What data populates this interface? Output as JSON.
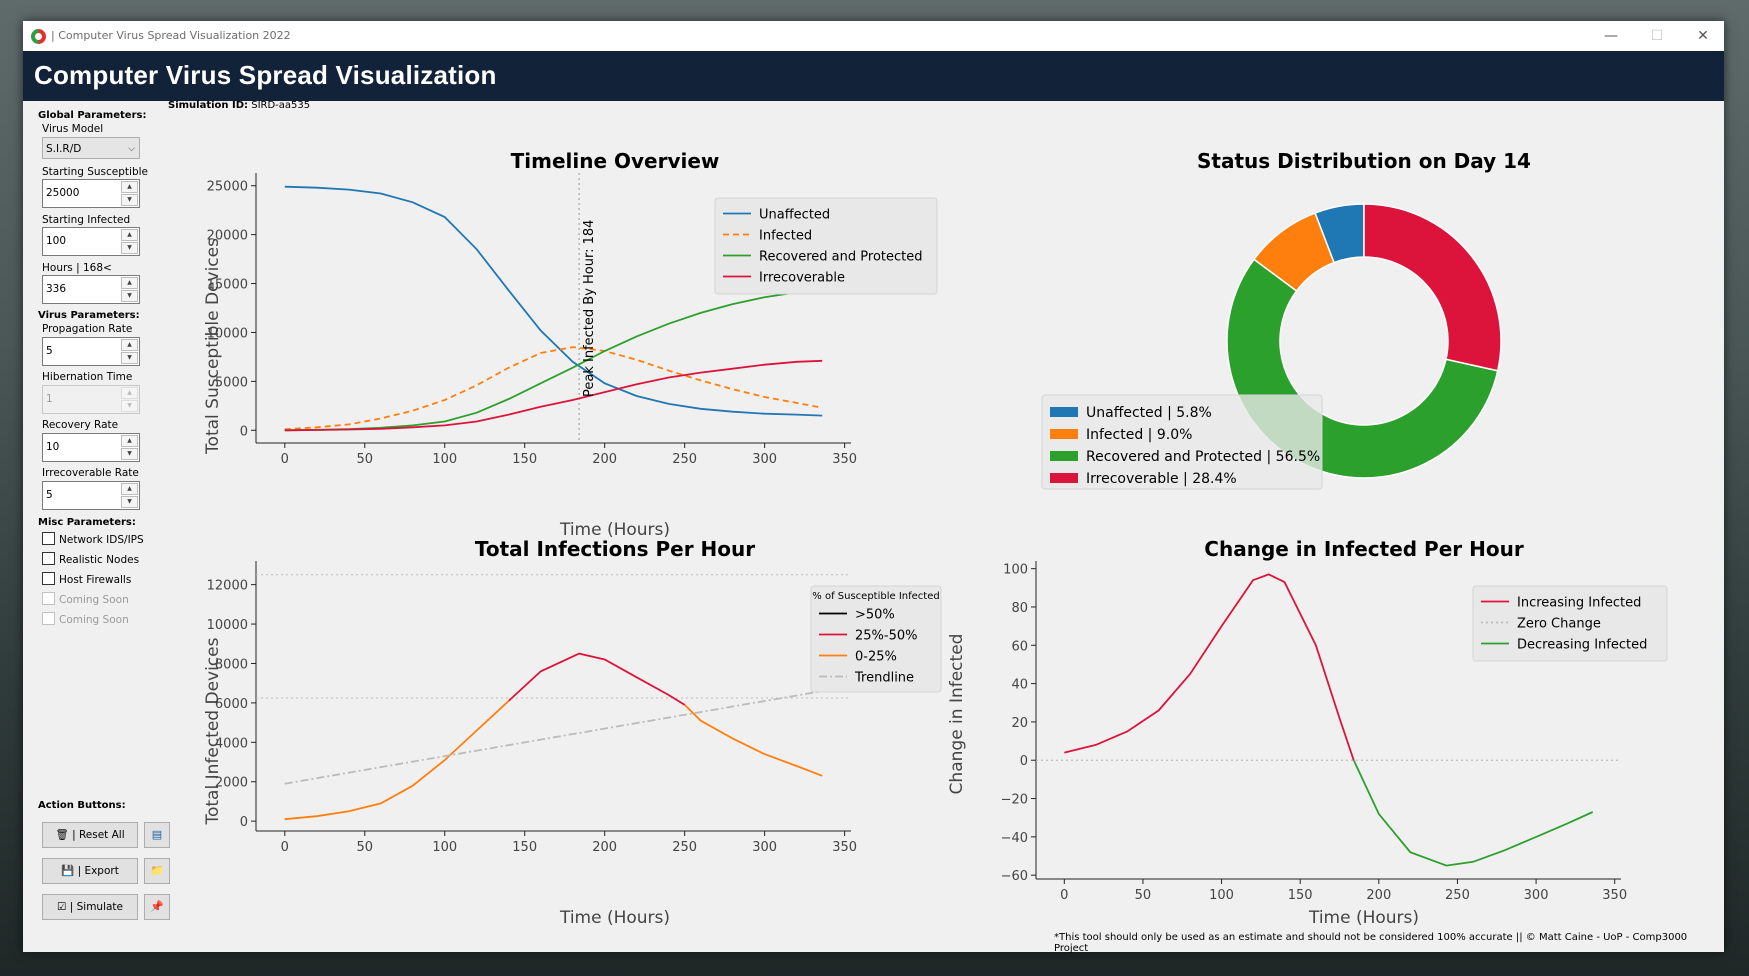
{
  "window": {
    "title": "| Computer Virus Spread Visualization 2022",
    "minimize": "—",
    "maximize": "☐",
    "close": "✕"
  },
  "header": {
    "title": "Computer Virus Spread Visualization"
  },
  "sidebar": {
    "global_heading": "Global Parameters:",
    "virus_model_label": "Virus Model",
    "virus_model_value": "S.I.R/D",
    "starting_susceptible_label": "Starting Susceptible",
    "starting_susceptible_value": "25000",
    "starting_infected_label": "Starting Infected",
    "starting_infected_value": "100",
    "hours_label": "Hours | 168<",
    "hours_value": "336",
    "virus_heading": "Virus Parameters:",
    "propagation_label": "Propagation Rate",
    "propagation_value": "5",
    "hibernation_label": "Hibernation Time",
    "hibernation_value": "1",
    "recovery_label": "Recovery Rate",
    "recovery_value": "10",
    "irrecoverable_label": "Irrecoverable Rate",
    "irrecoverable_value": "5",
    "misc_heading": "Misc Parameters:",
    "misc": [
      "Network IDS/IPS",
      "Realistic Nodes",
      "Host Firewalls",
      "Coming Soon",
      "Coming Soon"
    ],
    "action_heading": "Action Buttons:",
    "reset_label": "| Reset All",
    "export_label": "| Export",
    "simulate_label": "| Simulate",
    "spin_up": "▲",
    "spin_down": "▼",
    "combo_arrow": "⌵",
    "icons": {
      "reset": "🗑",
      "export": "💾",
      "simulate": "☑",
      "side1": "▤",
      "side2": "📁",
      "side3": "📌"
    }
  },
  "simulation": {
    "label": "Simulation ID:",
    "id": "SIRD-aa535"
  },
  "footer": "*This tool should only be used as an estimate and should not be considered 100% accurate || © Matt Caine - UoP - Comp3000 Project",
  "colors": {
    "blue": "#1f77b4",
    "orange": "#ff7f0e",
    "green": "#2ca02c",
    "red": "#dc143c",
    "header": "#122238"
  },
  "chart_data": [
    {
      "type": "line",
      "title": "Timeline Overview",
      "xlabel": "Time (Hours)",
      "ylabel": "Total Susceptible Devices",
      "xlim": [
        -18,
        354
      ],
      "ylim": [
        -1300,
        26300
      ],
      "xticks": [
        0,
        50,
        100,
        150,
        200,
        250,
        300,
        350
      ],
      "yticks": [
        0,
        5000,
        10000,
        15000,
        20000,
        25000
      ],
      "legend_position": "top-right",
      "annotation": {
        "text": "Peak Infected By Hour: 184",
        "x": 184
      },
      "series": [
        {
          "name": "Unaffected",
          "color": "#1f77b4",
          "dash": "",
          "x": [
            0,
            20,
            40,
            60,
            80,
            100,
            120,
            140,
            160,
            180,
            200,
            220,
            240,
            260,
            280,
            300,
            320,
            336
          ],
          "y": [
            24900,
            24800,
            24600,
            24200,
            23300,
            21800,
            18500,
            14300,
            10200,
            7000,
            4800,
            3500,
            2700,
            2200,
            1900,
            1700,
            1600,
            1500
          ]
        },
        {
          "name": "Infected",
          "color": "#ff7f0e",
          "dash": "6,4",
          "x": [
            0,
            20,
            40,
            60,
            80,
            100,
            120,
            140,
            160,
            180,
            200,
            220,
            240,
            260,
            280,
            300,
            320,
            336
          ],
          "y": [
            100,
            300,
            600,
            1200,
            2000,
            3100,
            4600,
            6400,
            7900,
            8500,
            8100,
            7200,
            6100,
            5100,
            4200,
            3400,
            2800,
            2300
          ]
        },
        {
          "name": "Recovered and Protected",
          "color": "#2ca02c",
          "dash": "",
          "x": [
            0,
            20,
            40,
            60,
            80,
            100,
            120,
            140,
            160,
            180,
            200,
            220,
            240,
            260,
            280,
            300,
            320,
            336
          ],
          "y": [
            0,
            50,
            120,
            250,
            500,
            900,
            1800,
            3200,
            4800,
            6400,
            8100,
            9600,
            10900,
            12000,
            12900,
            13600,
            14100,
            14300
          ]
        },
        {
          "name": "Irrecoverable",
          "color": "#dc143c",
          "dash": "",
          "x": [
            0,
            20,
            40,
            60,
            80,
            100,
            120,
            140,
            160,
            180,
            200,
            220,
            240,
            260,
            280,
            300,
            320,
            336
          ],
          "y": [
            0,
            30,
            80,
            150,
            300,
            500,
            900,
            1600,
            2400,
            3100,
            3900,
            4700,
            5400,
            5900,
            6300,
            6700,
            7000,
            7100
          ]
        }
      ]
    },
    {
      "type": "pie",
      "title": "Status Distribution on Day 14",
      "donut": true,
      "legend_position": "lower-left",
      "slices": [
        {
          "label": "Unaffected | 5.8%",
          "value": 5.8,
          "color": "#1f77b4"
        },
        {
          "label": "Infected | 9.0%",
          "value": 9.0,
          "color": "#ff7f0e"
        },
        {
          "label": "Recovered and Protected | 56.5%",
          "value": 56.5,
          "color": "#2ca02c"
        },
        {
          "label": "Irrecoverable | 28.4%",
          "value": 28.4,
          "color": "#dc143c"
        }
      ]
    },
    {
      "type": "line",
      "title": "Total Infections Per Hour",
      "xlabel": "Time (Hours)",
      "ylabel": "Total Infected Devices",
      "xlim": [
        -18,
        354
      ],
      "ylim": [
        -500,
        13200
      ],
      "xticks": [
        0,
        50,
        100,
        150,
        200,
        250,
        300,
        350
      ],
      "yticks": [
        0,
        2000,
        4000,
        6000,
        8000,
        10000,
        12000
      ],
      "legend_title": "% of Susceptible Infected",
      "legend_position": "top-right",
      "thresholds": [
        6250,
        12500
      ],
      "legend": [
        {
          "name": ">50%",
          "color": "#000000",
          "dash": ""
        },
        {
          "name": "25%-50%",
          "color": "#dc143c",
          "dash": ""
        },
        {
          "name": "0-25%",
          "color": "#ff7f0e",
          "dash": ""
        },
        {
          "name": "Trendline",
          "color": "#bbbbbb",
          "dash": "8,3,2,3"
        }
      ],
      "series": [
        {
          "name": "0-25%",
          "color": "#ff7f0e",
          "dash": "",
          "x": [
            0,
            20,
            40,
            60,
            80,
            100,
            120,
            140
          ],
          "y": [
            100,
            250,
            500,
            900,
            1800,
            3100,
            4600,
            6100
          ]
        },
        {
          "name": "25%-50%",
          "color": "#dc143c",
          "dash": "",
          "x": [
            140,
            160,
            184,
            200,
            220,
            240,
            250
          ],
          "y": [
            6100,
            7600,
            8500,
            8200,
            7300,
            6400,
            5900
          ]
        },
        {
          "name": "0-25%",
          "color": "#ff7f0e",
          "dash": "",
          "x": [
            250,
            260,
            280,
            300,
            320,
            336
          ],
          "y": [
            5900,
            5100,
            4200,
            3400,
            2800,
            2300
          ]
        },
        {
          "name": "Trendline",
          "color": "#bbbbbb",
          "dash": "8,3,2,3",
          "x": [
            0,
            336
          ],
          "y": [
            1900,
            6600
          ]
        }
      ]
    },
    {
      "type": "line",
      "title": "Change in Infected Per Hour",
      "xlabel": "Time (Hours)",
      "ylabel": "Change in Infected",
      "xlim": [
        -18,
        354
      ],
      "ylim": [
        -62,
        104
      ],
      "xticks": [
        0,
        50,
        100,
        150,
        200,
        250,
        300,
        350
      ],
      "yticks": [
        -60,
        -40,
        -20,
        0,
        20,
        40,
        60,
        80,
        100
      ],
      "legend_position": "top-right",
      "legend": [
        {
          "name": "Increasing Infected",
          "color": "#dc143c",
          "dash": ""
        },
        {
          "name": "Zero Change",
          "color": "#bbbbbb",
          "dash": "2,3"
        },
        {
          "name": "Decreasing  Infected",
          "color": "#2ca02c",
          "dash": ""
        }
      ],
      "zero_line": 0,
      "series": [
        {
          "name": "Increasing Infected",
          "color": "#dc143c",
          "dash": "",
          "x": [
            0,
            20,
            40,
            60,
            80,
            100,
            120,
            130,
            140,
            160,
            175,
            184
          ],
          "y": [
            4,
            8,
            15,
            26,
            45,
            70,
            94,
            97,
            93,
            60,
            22,
            0
          ]
        },
        {
          "name": "Decreasing  Infected",
          "color": "#2ca02c",
          "dash": "",
          "x": [
            184,
            200,
            220,
            243,
            260,
            280,
            300,
            320,
            336
          ],
          "y": [
            0,
            -28,
            -48,
            -55,
            -53,
            -47,
            -40,
            -33,
            -27
          ]
        }
      ]
    }
  ]
}
